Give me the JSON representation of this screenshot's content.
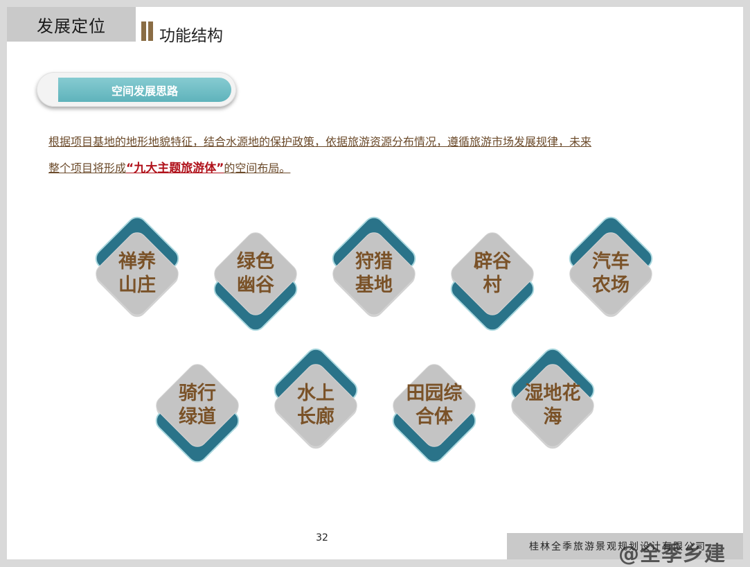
{
  "header": {
    "section": "发展定位",
    "subtitle": "功能结构"
  },
  "pill": {
    "label": "空间发展思路"
  },
  "description": {
    "line1": "根据项目基地的地形地貌特征，结合水源地的保护政策，依据旅游资源分布情况，遵循旅游市场发展规律，未来",
    "line2_prefix": "整个项目将形成",
    "highlight": "“九大主题旅游体”",
    "line2_suffix": "的空间布局。"
  },
  "colors": {
    "teal": "#2a7389",
    "gray_diamond": "#c4c4c4",
    "label_brown": "#7a5228",
    "highlight_red": "#b0121b"
  },
  "nodes": [
    {
      "line1": "禅养",
      "line2": "山庄",
      "accent": "top"
    },
    {
      "line1": "绿色",
      "line2": "幽谷",
      "accent": "bottom"
    },
    {
      "line1": "狩猎",
      "line2": "基地",
      "accent": "top"
    },
    {
      "line1": "辟谷",
      "line2": "村",
      "accent": "bottom"
    },
    {
      "line1": "汽车",
      "line2": "农场",
      "accent": "top"
    },
    {
      "line1": "骑行",
      "line2": "绿道",
      "accent": "bottom"
    },
    {
      "line1": "水上",
      "line2": "长廊",
      "accent": "top"
    },
    {
      "line1": "田园综",
      "line2": "合体",
      "accent": "bottom"
    },
    {
      "line1": "湿地花",
      "line2": "海",
      "accent": "top"
    }
  ],
  "footer": {
    "page_number": "32",
    "company": "桂林全季旅游景观规划设计有限公司",
    "watermark": "@全季乡建"
  }
}
